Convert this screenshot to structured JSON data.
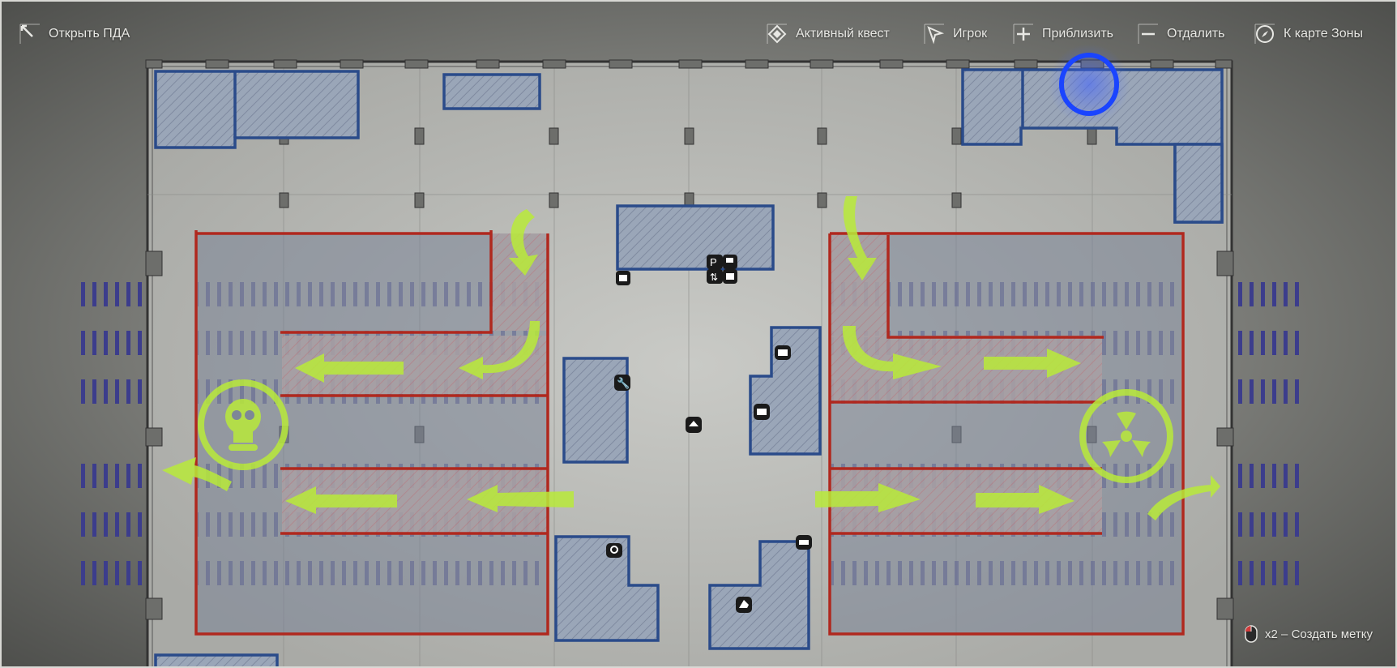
{
  "toolbar": {
    "open_pda": "Открыть ПДА",
    "active_quest": "Активный квест",
    "player": "Игрок",
    "zoom_in": "Приблизить",
    "zoom_out": "Отдалить",
    "zone_map": "К карте Зоны"
  },
  "hint": {
    "text": "x2 – Создать метку"
  },
  "colors": {
    "zone_border": "#b0281e",
    "building": "#2a4b8a",
    "route_arrow": "#b9ea3a",
    "marker": "#1a44ff",
    "rails": "#3a3a8a"
  },
  "icons": [
    "arrow-expand-icon",
    "diamond-quest-icon",
    "cursor-player-icon",
    "plus-icon",
    "minus-icon",
    "compass-icon",
    "mouse-icon",
    "skull-icon",
    "radiation-icon",
    "wrench-icon",
    "mail-icon",
    "shop-icon",
    "search-icon",
    "home-icon",
    "box-icon",
    "parking-icon"
  ]
}
